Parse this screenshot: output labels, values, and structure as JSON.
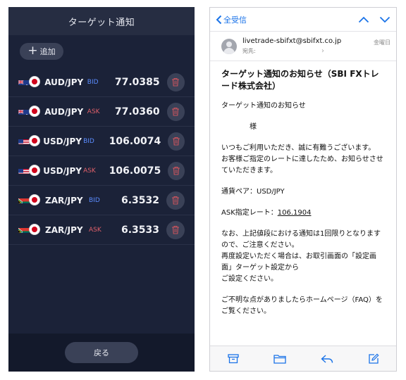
{
  "left": {
    "header_title": "ターゲット通知",
    "add_label": "追加",
    "back_label": "戻る",
    "rows": [
      {
        "pair": "AUD/JPY",
        "side": "BID",
        "side_class": "bid",
        "price": "77.0385",
        "flag": "au"
      },
      {
        "pair": "AUD/JPY",
        "side": "ASK",
        "side_class": "ask",
        "price": "77.0360",
        "flag": "au"
      },
      {
        "pair": "USD/JPY",
        "side": "BID",
        "side_class": "bid",
        "price": "106.0074",
        "flag": "us"
      },
      {
        "pair": "USD/JPY",
        "side": "ASK",
        "side_class": "ask",
        "price": "106.0075",
        "flag": "us"
      },
      {
        "pair": "ZAR/JPY",
        "side": "BID",
        "side_class": "bid",
        "price": "6.3532",
        "flag": "za"
      },
      {
        "pair": "ZAR/JPY",
        "side": "ASK",
        "side_class": "ask",
        "price": "6.3533",
        "flag": "za"
      }
    ],
    "colors": {
      "bid": "#5b8cff",
      "ask": "#e0606a",
      "background": "#1b2238"
    }
  },
  "right": {
    "back_label": "全受信",
    "from": "livetrade-sbifxt@sbifxt.co.jp",
    "to_label": "宛先:",
    "date": "金曜日",
    "subject": "ターゲット通知のお知らせ（SBI FXトレード株式会社）",
    "body": {
      "line1": "ターゲット通知のお知らせ",
      "line2": "様",
      "line3": "いつもご利用いただき、誠に有難うございます。",
      "line4": "お客様ご指定のレートに達したため、お知らせさせていただきます。",
      "pair_line": "通貨ペア：USD/JPY",
      "ask_label": "ASK指定レート：",
      "ask_value": "106.1904",
      "line5": "なお、上記値段における通知は1回限りとなりますので、ご注意ください。",
      "line6": "再度設定いただく場合は、お取引画面の「設定画面」ターゲット設定から",
      "line7": "ご設定ください。",
      "line8": "ご不明な点がありましたらホームページ（FAQ）をご覧ください。"
    },
    "toolbar_icons": [
      "archive-icon",
      "folder-icon",
      "reply-icon",
      "compose-icon"
    ],
    "accent": "#1a73e8"
  }
}
